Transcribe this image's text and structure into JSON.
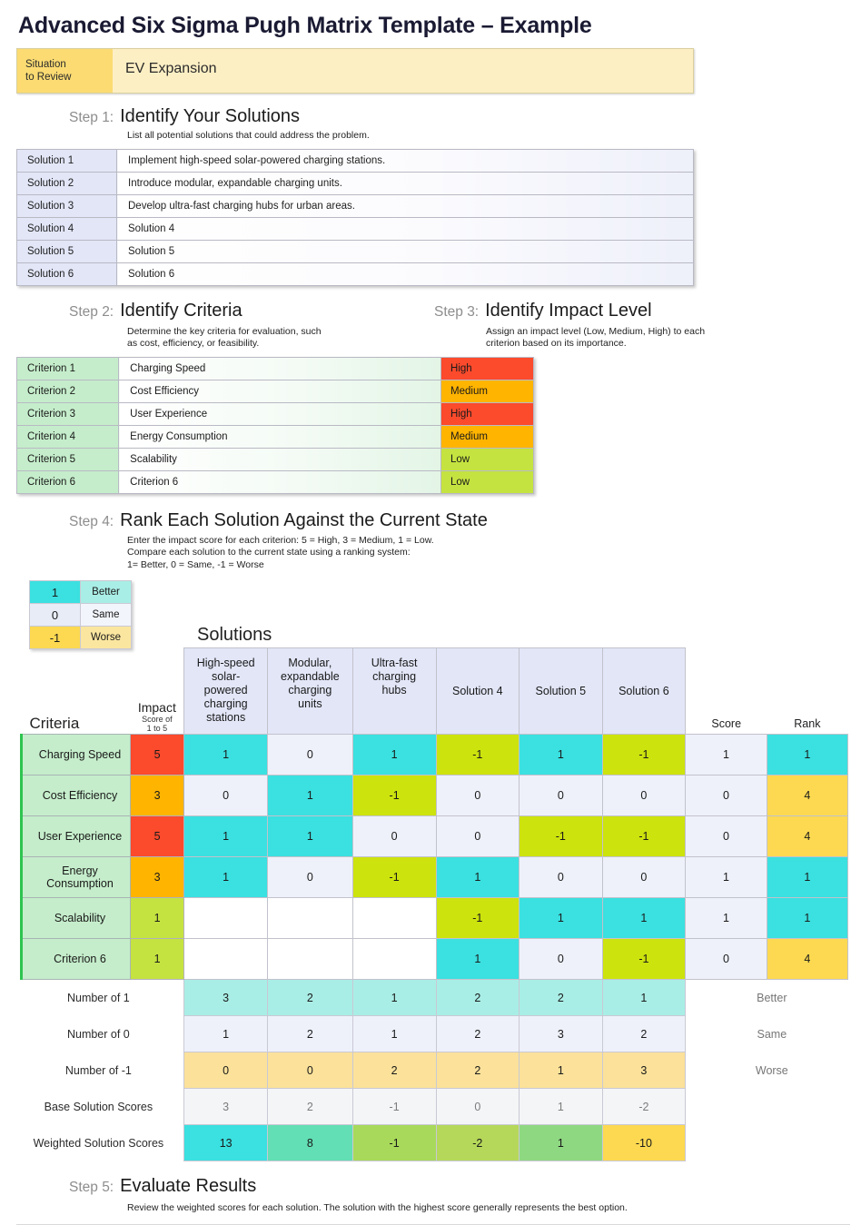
{
  "title": "Advanced Six Sigma Pugh Matrix Template – Example",
  "situation": {
    "label": "Situation\nto Review",
    "label_line1": "Situation",
    "label_line2": "to Review",
    "value": "EV Expansion"
  },
  "steps": {
    "step1": {
      "num": "Step 1:",
      "title": "Identify Your Solutions",
      "desc": "List all potential solutions that could address the problem."
    },
    "step2": {
      "num": "Step 2:",
      "title": "Identify Criteria",
      "desc_line1": "Determine the key criteria for evaluation, such",
      "desc_line2": "as cost, efficiency, or feasibility."
    },
    "step3": {
      "num": "Step 3:",
      "title": "Identify Impact Level",
      "desc_line1": "Assign an impact level (Low, Medium, High) to each",
      "desc_line2": "criterion based on its importance."
    },
    "step4": {
      "num": "Step 4:",
      "title": "Rank Each Solution Against the Current State",
      "desc_line1": "Enter the impact score for each criterion: 5 = High, 3 = Medium, 1 = Low.",
      "desc_line2": "Compare each solution to the current state using a ranking system:",
      "desc_line3": "1= Better, 0 = Same, -1 = Worse"
    },
    "step5": {
      "num": "Step 5:",
      "title": "Evaluate Results",
      "desc": "Review the weighted scores for each solution. The solution with the highest score generally represents the best option."
    }
  },
  "solutions_table": {
    "rows": [
      {
        "key": "Solution 1",
        "value": "Implement high-speed solar-powered charging stations."
      },
      {
        "key": "Solution 2",
        "value": "Introduce modular, expandable charging units."
      },
      {
        "key": "Solution 3",
        "value": "Develop ultra-fast charging hubs for urban areas."
      },
      {
        "key": "Solution 4",
        "value": "Solution 4"
      },
      {
        "key": "Solution 5",
        "value": "Solution 5"
      },
      {
        "key": "Solution 6",
        "value": "Solution 6"
      }
    ]
  },
  "criteria_table": {
    "rows": [
      {
        "key": "Criterion 1",
        "value": "Charging Speed",
        "impact": "High"
      },
      {
        "key": "Criterion 2",
        "value": "Cost Efficiency",
        "impact": "Medium"
      },
      {
        "key": "Criterion 3",
        "value": "User Experience",
        "impact": "High"
      },
      {
        "key": "Criterion 4",
        "value": "Energy Consumption",
        "impact": "Medium"
      },
      {
        "key": "Criterion 5",
        "value": "Scalability",
        "impact": "Low"
      },
      {
        "key": "Criterion 6",
        "value": "Criterion 6",
        "impact": "Low"
      }
    ]
  },
  "legend": {
    "rows": [
      {
        "score": "1",
        "word": "Better"
      },
      {
        "score": "0",
        "word": "Same"
      },
      {
        "score": "-1",
        "word": "Worse"
      }
    ]
  },
  "matrix": {
    "solutions_heading": "Solutions",
    "criteria_heading": "Criteria",
    "impact_heading": "Impact",
    "impact_sub_line1": "Score of",
    "impact_sub_line2": "1 to 5",
    "score_heading": "Score",
    "rank_heading": "Rank",
    "columns": [
      "High-speed solar-powered charging stations",
      "Modular, expandable charging units",
      "Ultra-fast charging hubs",
      "Solution 4",
      "Solution 5",
      "Solution 6"
    ],
    "rows": [
      {
        "criterion": "Charging Speed",
        "impact": "5",
        "values": [
          "1",
          "0",
          "1",
          "-1",
          "1",
          "-1"
        ],
        "score": "1",
        "rank": "1"
      },
      {
        "criterion": "Cost Efficiency",
        "impact": "3",
        "values": [
          "0",
          "1",
          "-1",
          "0",
          "0",
          "0"
        ],
        "score": "0",
        "rank": "4"
      },
      {
        "criterion": "User Experience",
        "impact": "5",
        "values": [
          "1",
          "1",
          "0",
          "0",
          "-1",
          "-1"
        ],
        "score": "0",
        "rank": "4"
      },
      {
        "criterion": "Energy Consumption",
        "impact": "3",
        "values": [
          "1",
          "0",
          "-1",
          "1",
          "0",
          "0"
        ],
        "score": "1",
        "rank": "1"
      },
      {
        "criterion": "Scalability",
        "impact": "1",
        "values": [
          "",
          "",
          "",
          "-1",
          "1",
          "1"
        ],
        "score": "1",
        "rank": "1"
      },
      {
        "criterion": "Criterion 6",
        "impact": "1",
        "values": [
          "",
          "",
          "",
          "1",
          "0",
          "-1"
        ],
        "score": "0",
        "rank": "4"
      }
    ],
    "summary": [
      {
        "label": "Number of 1",
        "values": [
          "3",
          "2",
          "1",
          "2",
          "2",
          "1"
        ],
        "word": "Better"
      },
      {
        "label": "Number of 0",
        "values": [
          "1",
          "2",
          "1",
          "2",
          "3",
          "2"
        ],
        "word": "Same"
      },
      {
        "label": "Number of -1",
        "values": [
          "0",
          "0",
          "2",
          "2",
          "1",
          "3"
        ],
        "word": "Worse"
      }
    ],
    "base_scores": {
      "label": "Base Solution Scores",
      "values": [
        "3",
        "2",
        "-1",
        "0",
        "1",
        "-2"
      ]
    },
    "weighted_scores": {
      "label": "Weighted Solution Scores",
      "values": [
        "13",
        "8",
        "-1",
        "-2",
        "1",
        "-10"
      ]
    }
  },
  "colors": {
    "better": "#3be0e0",
    "same": "#eef1fa",
    "worse": "#cde30d",
    "high": "#fb4a2c",
    "medium": "#ffb400",
    "low": "#c5e340",
    "rank_low": "#fcd951",
    "criteria_green": "#c5edcb",
    "solution_blue": "#e2e6f7"
  }
}
